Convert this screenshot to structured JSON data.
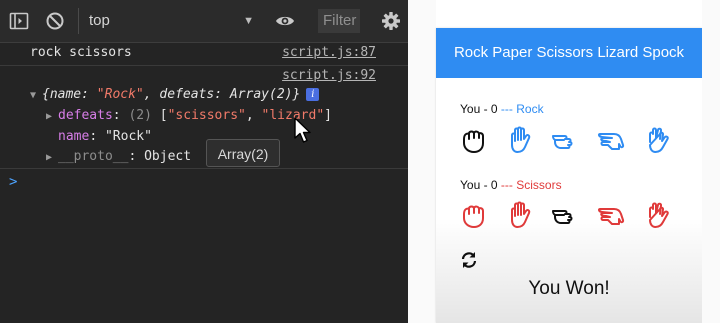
{
  "devtools": {
    "context": "top",
    "filter_placeholder": "Filter",
    "log1_text": "rock scissors",
    "log1_source": "script.js:87",
    "log2_source": "script.js:92",
    "obj_open": "{",
    "obj_name_key": "name",
    "obj_sep1": ": ",
    "obj_name_val": "\"Rock\"",
    "obj_comma": ", ",
    "obj_defeats_key": "defeats",
    "obj_sep2": ": ",
    "obj_defeats_val": "Array(2)",
    "obj_close": "}",
    "info_badge": "i",
    "defeats_key": "defeats",
    "defeats_colon": ":",
    "defeats_count": "(2)",
    "defeats_open": "[",
    "defeats_item1": "\"scissors\"",
    "defeats_comma": ", ",
    "defeats_item2": "\"lizard\"",
    "defeats_close": "]",
    "name_key": "name",
    "name_colon": ": ",
    "name_val": "\"Rock\"",
    "proto_key": "__proto__",
    "proto_colon": ": ",
    "proto_val": "Object",
    "tooltip": "Array(2)",
    "prompt": ">"
  },
  "app": {
    "title": "Rock Paper Scissors Lizard Spock",
    "player1": {
      "label": "You - 0 ",
      "pick": "--- Rock",
      "color": "#2f8cf2"
    },
    "player2": {
      "label": "You - 0 ",
      "pick": "--- Scissors",
      "color": "#e03a3a"
    },
    "result": "You Won!",
    "hand_names": [
      "rock",
      "paper",
      "scissors",
      "lizard",
      "spock"
    ]
  }
}
